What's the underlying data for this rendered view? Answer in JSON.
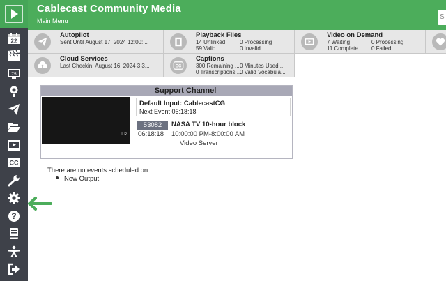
{
  "header": {
    "title": "Cablecast Community Media",
    "subtitle": "Main Menu",
    "color": "#4cad5b"
  },
  "sidebar": {
    "background": "#3e4149",
    "items": [
      {
        "icon": "calendar-22-icon",
        "text": "22"
      },
      {
        "icon": "clapperboard-icon"
      },
      {
        "icon": "monitor-75-icon",
        "text": "75"
      },
      {
        "icon": "podcast-icon"
      },
      {
        "icon": "paper-plane-icon"
      },
      {
        "icon": "folder-open-icon"
      },
      {
        "icon": "video-display-icon"
      },
      {
        "icon": "closed-captions-icon",
        "text": "CC"
      },
      {
        "icon": "wrench-icon"
      },
      {
        "icon": "gear-icon"
      },
      {
        "icon": "help-circle-icon",
        "text": "?"
      },
      {
        "icon": "book-icon"
      },
      {
        "icon": "accessibility-icon"
      },
      {
        "icon": "sign-out-icon"
      }
    ]
  },
  "tiles": {
    "autopilot": {
      "title": "Autopilot",
      "line1": "Sent Until August 17, 2024 12:00:..."
    },
    "playback": {
      "title": "Playback Files",
      "a1": "14 Unlinked",
      "a2": "59 Valid",
      "b1": "0 Processing",
      "b2": "0 Invalid"
    },
    "vod": {
      "title": "Video on Demand",
      "a1": "7 Waiting",
      "a2": "11 Complete",
      "b1": "0 Processing",
      "b2": "0 Failed"
    },
    "cloud": {
      "title": "Cloud Services",
      "line1": "Last Checkin: August 16, 2024 3:3..."
    },
    "captions": {
      "title": "Captions",
      "a1": "300 Remaining ...",
      "a2": "0 Transcriptions ...",
      "b1": "0 Minutes Used ...",
      "b2": "0 Valid Vocabula...",
      "icon_text": "CC"
    }
  },
  "support": {
    "title": "Support Channel",
    "preview_mark": "L R",
    "default_input": "Default Input: CablecastCG",
    "next_event": "Next Event 06:18:18",
    "show_id": "53082",
    "show_title": "NASA TV 10-hour block",
    "show_time": "06:18:18",
    "show_range": "10:00:00 PM-8:00:00 AM",
    "server": "Video Server"
  },
  "events": {
    "message": "There are no events scheduled on:",
    "items": [
      "New Output"
    ]
  },
  "pointer_color": "#4cad5b"
}
